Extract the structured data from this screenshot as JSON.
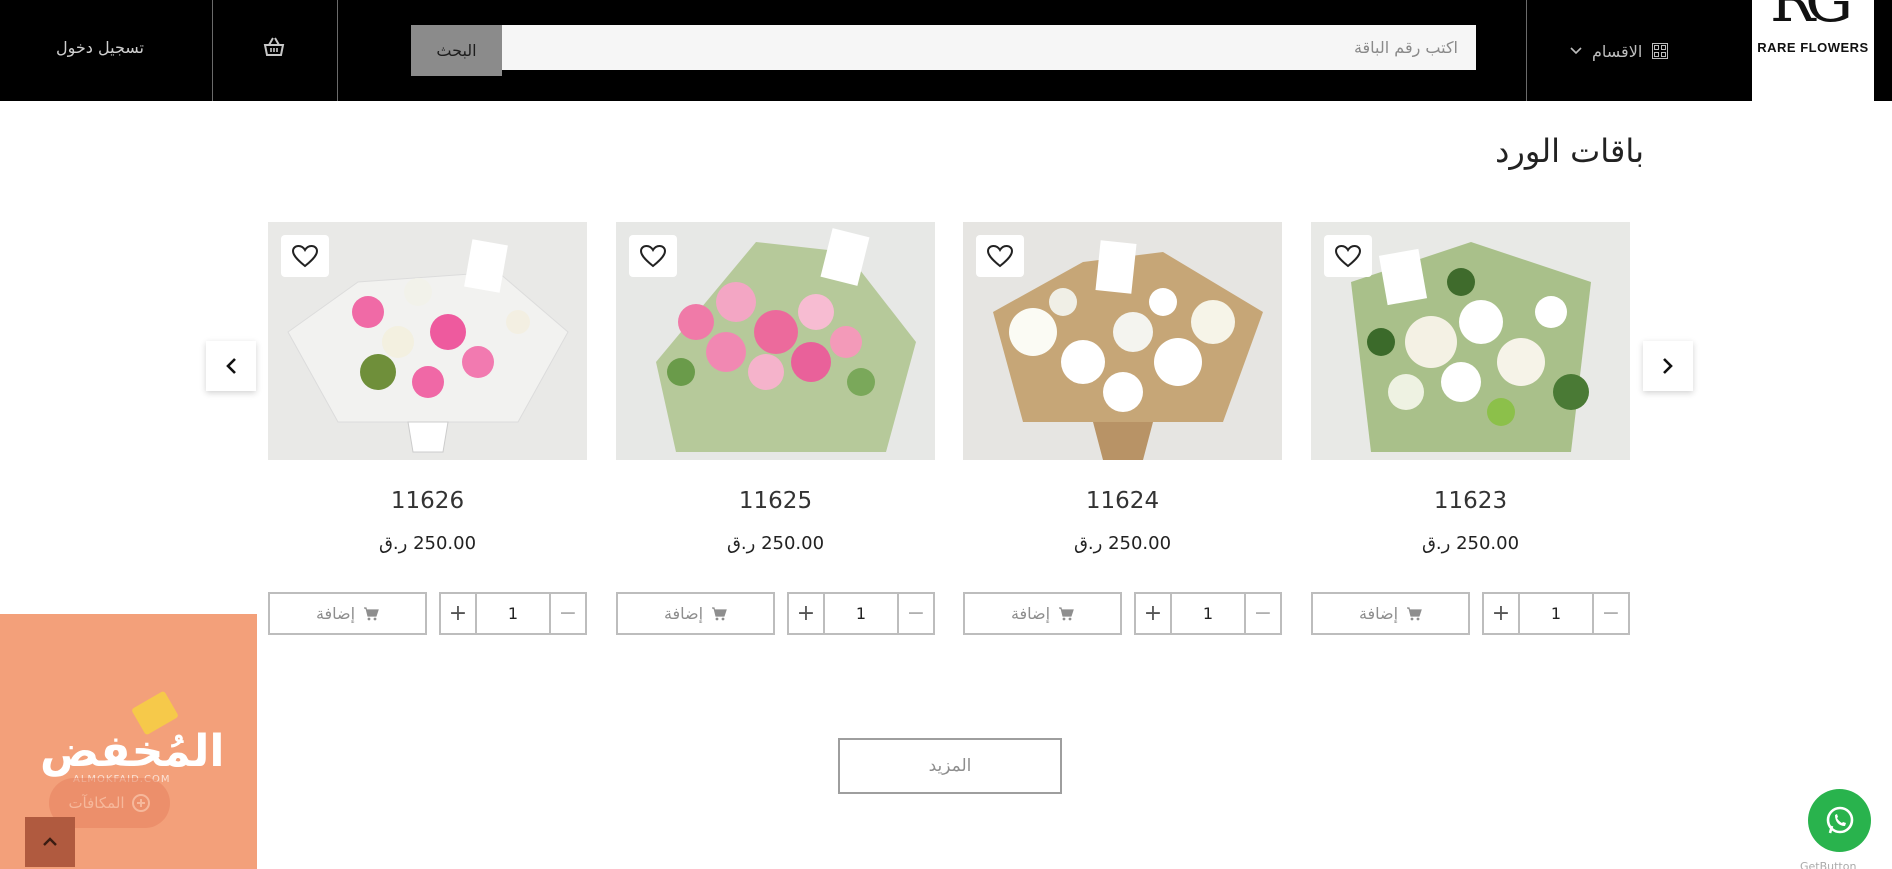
{
  "header": {
    "logo_text": "RARE FLOWERS",
    "logo_mark": "RG",
    "categories_label": "الاقسام",
    "search_placeholder": "اكتب رقم الباقة",
    "search_button": "البحث",
    "login_label": "تسجيل دخول"
  },
  "section": {
    "title": "باقات الورد",
    "products": [
      {
        "code": "11623",
        "price": "250.00 ر.ق",
        "quantity": "1",
        "add_label": "إضافة"
      },
      {
        "code": "11624",
        "price": "250.00 ر.ق",
        "quantity": "1",
        "add_label": "إضافة"
      },
      {
        "code": "11625",
        "price": "250.00 ر.ق",
        "quantity": "1",
        "add_label": "إضافة"
      },
      {
        "code": "11626",
        "price": "250.00 ر.ق",
        "quantity": "1",
        "add_label": "إضافة"
      }
    ],
    "more_button": "المزيد"
  },
  "promo": {
    "brand": "المُخفض",
    "domain": "ALMOKFAID.COM",
    "rewards_label": "المكافآت"
  },
  "widgets": {
    "getbutton": "GetButton"
  },
  "colors": {
    "header_bg": "#000000",
    "search_button_bg": "#8b8b8b",
    "promo_bg": "#f3a07a",
    "whatsapp": "#29b34d"
  },
  "icons": [
    "grid-icon",
    "chevron-down-icon",
    "cart-icon",
    "heart-icon",
    "chevron-left-icon",
    "chevron-right-icon",
    "plus-icon",
    "minus-icon",
    "chevron-up-icon",
    "whatsapp-icon",
    "gift-icon"
  ]
}
